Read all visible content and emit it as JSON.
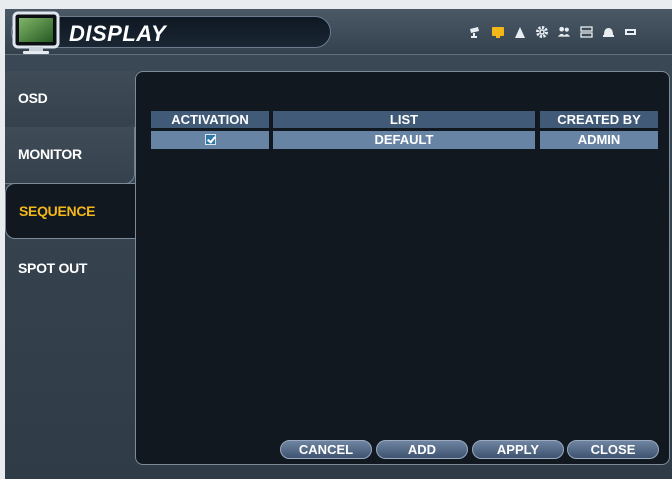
{
  "header": {
    "title": "DISPLAY",
    "icons": [
      "camera-icon",
      "display-icon",
      "record-icon",
      "gear-icon",
      "users-icon",
      "storage-icon",
      "alarm-icon",
      "system-icon"
    ]
  },
  "sidebar": {
    "items": [
      {
        "label": "OSD",
        "active": false
      },
      {
        "label": "MONITOR",
        "active": false
      },
      {
        "label": "SEQUENCE",
        "active": true
      },
      {
        "label": "SPOT OUT",
        "active": false
      }
    ]
  },
  "table": {
    "columns": [
      "ACTIVATION",
      "LIST",
      "CREATED BY"
    ],
    "rows": [
      {
        "activation": true,
        "list": "DEFAULT",
        "created_by": "ADMIN"
      }
    ]
  },
  "buttons": {
    "cancel": "CANCEL",
    "add": "ADD",
    "apply": "APPLY",
    "close": "CLOSE"
  },
  "colors": {
    "accent_active": "#f3b71a",
    "header_cell": "#405a78",
    "data_cell": "#6884a4",
    "checkbox": "#2e79a8"
  }
}
